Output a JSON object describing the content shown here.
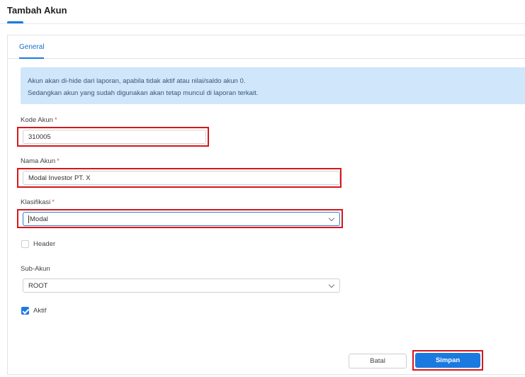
{
  "header": {
    "title": "Tambah Akun"
  },
  "tabs": [
    {
      "label": "General",
      "active": true
    }
  ],
  "info": {
    "line1": "Akun akan di-hide dari laporan, apabila tidak aktif atau nilai/saldo akun 0.",
    "line2": "Sedangkan akun yang sudah digunakan akan tetap muncul di laporan terkait."
  },
  "form": {
    "kode_akun": {
      "label": "Kode Akun",
      "required": "*",
      "value": "310005"
    },
    "nama_akun": {
      "label": "Nama Akun",
      "required": "*",
      "value": "Modal Investor PT. X"
    },
    "klasifikasi": {
      "label": "Klasifikasi",
      "required": "*",
      "value": "Modal"
    },
    "header_checkbox": {
      "label": "Header",
      "checked": false
    },
    "sub_akun": {
      "label": "Sub-Akun",
      "value": "ROOT"
    },
    "aktif_checkbox": {
      "label": "Aktif",
      "checked": true
    }
  },
  "actions": {
    "cancel_label": "Batal",
    "save_label": "Simpan"
  },
  "colors": {
    "accent": "#1b7ae0",
    "highlight": "#d6161b",
    "info_bg": "#cfe6fb"
  }
}
